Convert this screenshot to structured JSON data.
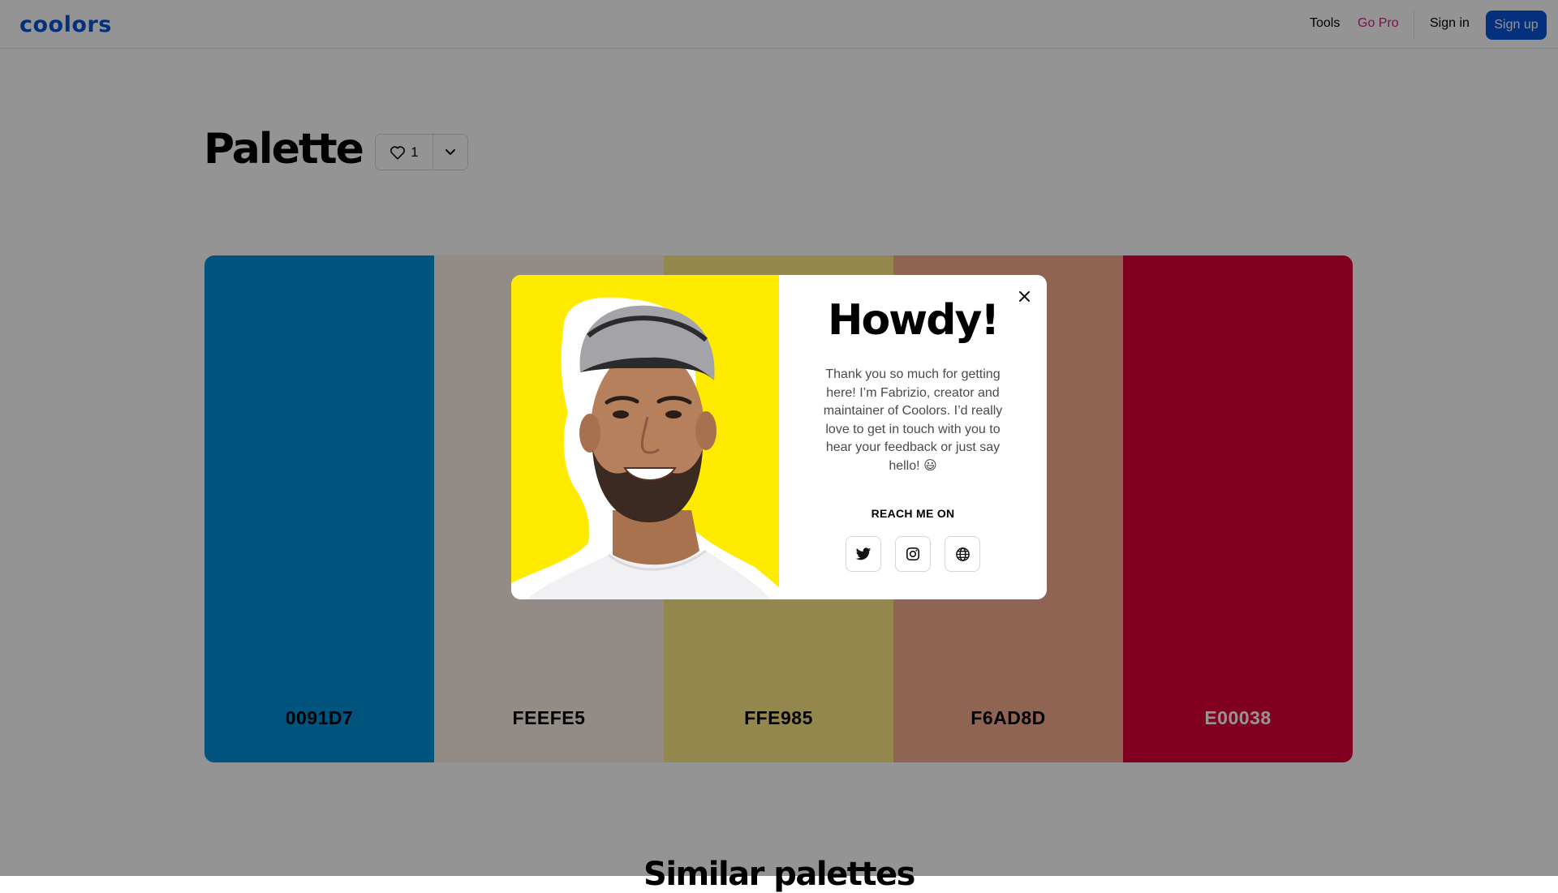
{
  "app": {
    "logo_text": "coolors",
    "brand_color": "#0a53d8"
  },
  "nav": {
    "tools": "Tools",
    "go_pro": "Go Pro",
    "go_pro_color": "#d1208f",
    "sign_in": "Sign in",
    "sign_up": "Sign up"
  },
  "page": {
    "title": "Palette",
    "likes": "1",
    "similar_title": "Similar palettes"
  },
  "palette": {
    "swatches": [
      {
        "hex": "0091D7",
        "color": "#0091D7",
        "text_color": "#000000"
      },
      {
        "hex": "FEEFE5",
        "color": "#FEEFE5",
        "text_color": "#000000"
      },
      {
        "hex": "FFE985",
        "color": "#FFE985",
        "text_color": "#000000"
      },
      {
        "hex": "F6AD8D",
        "color": "#F6AD8D",
        "text_color": "#000000"
      },
      {
        "hex": "E00038",
        "color": "#E00038",
        "text_color": "#ffffff"
      }
    ]
  },
  "overlay": {
    "color": "#000000",
    "opacity": 0.42
  },
  "modal": {
    "heading": "Howdy!",
    "message": "Thank you so much for getting here! I’m Fabrizio, creator and maintainer of Coolors. I’d really love to get in touch with you to hear your feedback or just say hello! 😃",
    "reach_label": "REACH ME ON",
    "photo_bg": "#ffeb00",
    "icons": {
      "close": "close-icon",
      "twitter": "twitter-icon",
      "instagram": "instagram-icon",
      "website": "globe-icon"
    }
  }
}
